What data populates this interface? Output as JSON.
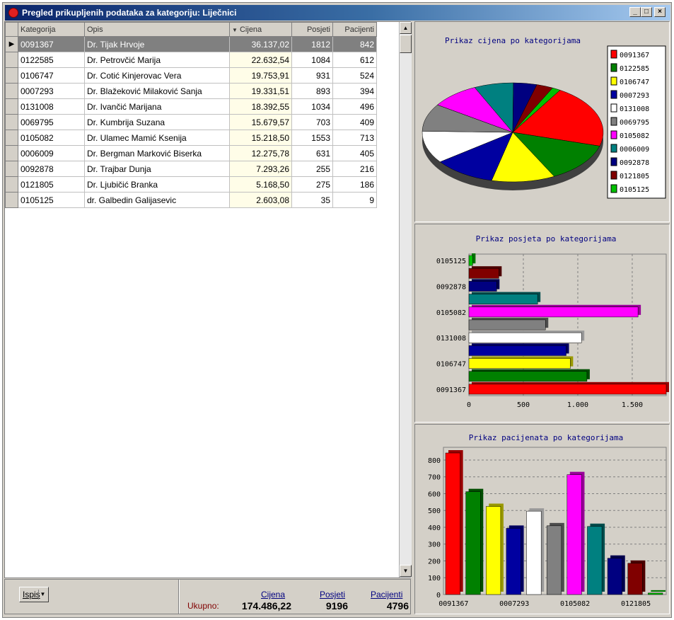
{
  "window": {
    "title": "Pregled prikupljenih podataka za kategoriju: Liječnici"
  },
  "table": {
    "headers": [
      "Kategorija",
      "Opis",
      "Cijena",
      "Posjeti",
      "Pacijenti"
    ],
    "sort_indicator": "▼",
    "rows": [
      [
        "0091367",
        "Dr. Tijak Hrvoje",
        "36.137,02",
        "1812",
        "842"
      ],
      [
        "0122585",
        "Dr. Petrovčić Marija",
        "22.632,54",
        "1084",
        "612"
      ],
      [
        "0106747",
        "Dr. Cotić Kinjerovac Vera",
        "19.753,91",
        "931",
        "524"
      ],
      [
        "0007293",
        "Dr. Blažeković Milaković Sanja",
        "19.331,51",
        "893",
        "394"
      ],
      [
        "0131008",
        "Dr. Ivančić Marijana",
        "18.392,55",
        "1034",
        "496"
      ],
      [
        "0069795",
        "Dr. Kumbrija Suzana",
        "15.679,57",
        "703",
        "409"
      ],
      [
        "0105082",
        "Dr. Ulamec Mamić Ksenija",
        "15.218,50",
        "1553",
        "713"
      ],
      [
        "0006009",
        "Dr. Bergman Marković Biserka",
        "12.275,78",
        "631",
        "405"
      ],
      [
        "0092878",
        "Dr. Trajbar Dunja",
        "7.293,26",
        "255",
        "216"
      ],
      [
        "0121805",
        "Dr. Ljubičić Branka",
        "5.168,50",
        "275",
        "186"
      ],
      [
        "0105125",
        "dr. Galbedin Galijasevic",
        "2.603,08",
        "35",
        "9"
      ]
    ]
  },
  "footer": {
    "print_button": "Ispis",
    "total_label": "Ukupno:",
    "col_cijena": "Cijena",
    "col_posjeti": "Posjeti",
    "col_pacijenti": "Pacijenti",
    "total_cijena": "174.486,22",
    "total_posjeti": "9196",
    "total_pacijenti": "4796"
  },
  "colors": [
    "#ff0000",
    "#008000",
    "#ffff00",
    "#0000a0",
    "#ffffff",
    "#808080",
    "#ff00ff",
    "#008080",
    "#000080",
    "#800000",
    "#00c000"
  ],
  "chart_data": [
    {
      "type": "pie",
      "title": "Prikaz cijena po kategorijama",
      "categories": [
        "0091367",
        "0122585",
        "0106747",
        "0007293",
        "0131008",
        "0069795",
        "0105082",
        "0006009",
        "0092878",
        "0121805",
        "0105125"
      ],
      "legend": [
        "0091367",
        "0122585",
        "0106747",
        "0007293",
        "0131008",
        "0069795",
        "0105082",
        "0006009",
        "0092878",
        "0121805",
        "0105125"
      ],
      "values": [
        36137.02,
        22632.54,
        19753.91,
        19331.51,
        18392.55,
        15679.57,
        15218.5,
        12275.78,
        7293.26,
        5168.5,
        2603.08
      ]
    },
    {
      "type": "bar",
      "orientation": "horizontal",
      "title": "Prikaz posjeta po kategorijama",
      "categories": [
        "0091367",
        "0122585",
        "0106747",
        "0007293",
        "0131008",
        "0069795",
        "0105082",
        "0006009",
        "0092878",
        "0121805",
        "0105125"
      ],
      "values": [
        1812,
        1084,
        931,
        893,
        1034,
        703,
        1553,
        631,
        255,
        275,
        35
      ],
      "tick_labels_y": [
        "0105125",
        "0092878",
        "0105082",
        "0131008",
        "0106747",
        "0091367"
      ],
      "tick_labels_x": [
        "0",
        "500",
        "1.000",
        "1.500"
      ],
      "xlim": [
        0,
        1812
      ]
    },
    {
      "type": "bar",
      "title": "Prikaz pacijenata po kategorijama",
      "categories": [
        "0091367",
        "0122585",
        "0106747",
        "0007293",
        "0131008",
        "0069795",
        "0105082",
        "0006009",
        "0092878",
        "0121805",
        "0105125"
      ],
      "values": [
        842,
        612,
        524,
        394,
        496,
        409,
        713,
        405,
        216,
        186,
        9
      ],
      "tick_labels_x": [
        "0091367",
        "0007293",
        "0105082",
        "0121805"
      ],
      "tick_labels_y": [
        "0",
        "100",
        "200",
        "300",
        "400",
        "500",
        "600",
        "700",
        "800"
      ],
      "ylim": [
        0,
        842
      ]
    }
  ]
}
